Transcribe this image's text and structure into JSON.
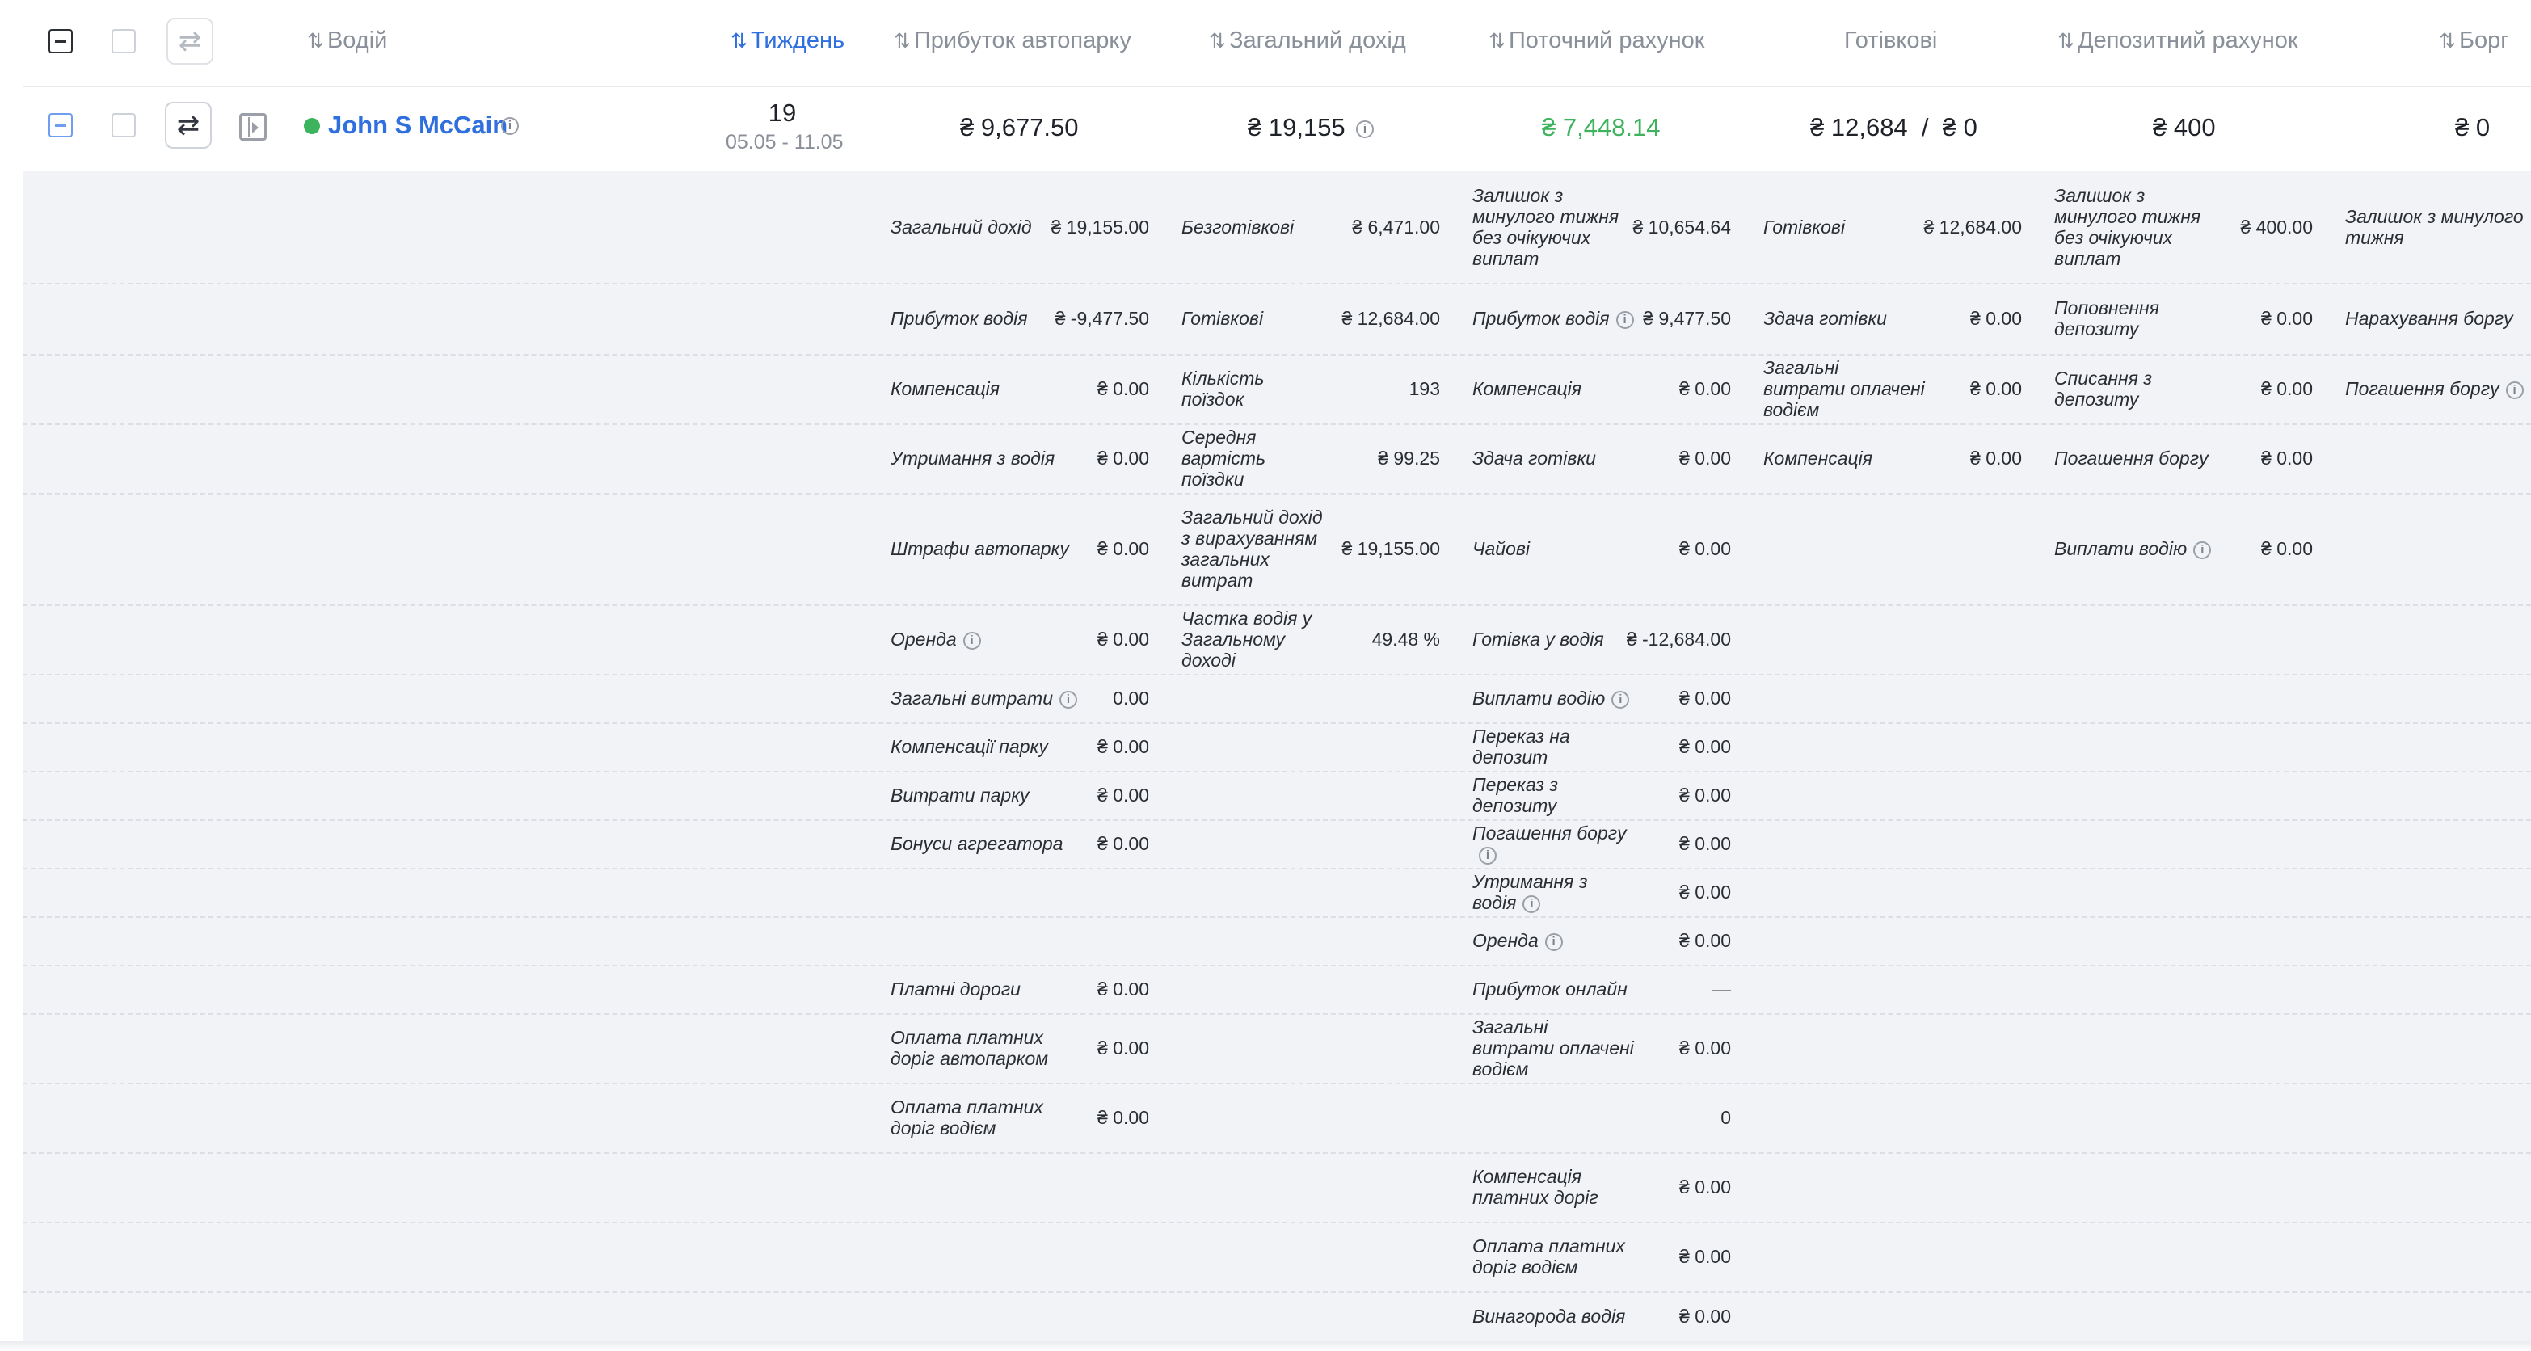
{
  "header": {
    "columns": [
      {
        "label": "Водій",
        "sort": "⇅"
      },
      {
        "label": "Тиждень",
        "sort": "⇅",
        "active": true
      },
      {
        "label": "Прибуток автопарку",
        "sort": "⇅"
      },
      {
        "label": "Загальний дохід",
        "sort": "⇅"
      },
      {
        "label": "Поточний рахунок",
        "sort": "⇅"
      },
      {
        "label": "Готівкові",
        "sort": ""
      },
      {
        "label": "Депозитний рахунок",
        "sort": "⇅"
      },
      {
        "label": "Борг",
        "sort": "⇅"
      }
    ],
    "swap_icon": "⇄"
  },
  "row": {
    "status_color": "#3cb35c",
    "driver_name": "John S McCain",
    "week_number": "19",
    "week_range": "05.05 - 11.05",
    "fleet_profit": "₴ 9,677.50",
    "total_income": "₴ 19,155",
    "current_account": "₴ 7,448.14",
    "cash": "₴ 12,684  /  ₴ 0",
    "deposit": "₴ 400",
    "debt": "₴ 0"
  },
  "colors": {
    "accent": "#2f6fde",
    "positive": "#3cb35c"
  },
  "details": {
    "col1": [
      {
        "label": "Загальний дохід",
        "value": "₴ 19,155.00"
      },
      {
        "label": "Прибуток водія",
        "value": "₴ -9,477.50"
      },
      {
        "label": "Компенсація",
        "value": "₴ 0.00"
      },
      {
        "label": "Утримання з водія",
        "value": "₴ 0.00"
      },
      {
        "label": "Штрафи автопарку",
        "value": "₴ 0.00"
      },
      {
        "label": "Оренда",
        "value": "₴ 0.00",
        "info": true
      },
      {
        "label": "Загальні витрати",
        "value": "0.00",
        "info": true
      },
      {
        "label": "Компенсації парку",
        "value": "₴ 0.00"
      },
      {
        "label": "Витрати парку",
        "value": "₴ 0.00"
      },
      {
        "label": "Бонуси агрегатора",
        "value": "₴ 0.00"
      },
      {
        "label": "Платні дороги",
        "value": "₴ 0.00"
      },
      {
        "label": "Оплата платних доріг автопарком",
        "value": "₴ 0.00"
      },
      {
        "label": "Оплата платних доріг водієм",
        "value": "₴ 0.00"
      }
    ],
    "col2": [
      {
        "label": "Безготівкові",
        "value": "₴ 6,471.00"
      },
      {
        "label": "Готівкові",
        "value": "₴ 12,684.00"
      },
      {
        "label": "Кількість поїздок",
        "value": "193"
      },
      {
        "label": "Середня вартість поїздки",
        "value": "₴ 99.25"
      },
      {
        "label": "Загальний дохід з вирахуванням загальних витрат",
        "value": "₴ 19,155.00"
      },
      {
        "label": "Частка водія у Загальному доході",
        "value": "49.48 %"
      }
    ],
    "col3": [
      {
        "label": "Залишок з минулого тижня без очікуючих виплат",
        "value": "₴ 10,654.64"
      },
      {
        "label": "Прибуток водія",
        "value": "₴ 9,477.50",
        "info": true
      },
      {
        "label": "Компенсація",
        "value": "₴ 0.00"
      },
      {
        "label": "Здача готівки",
        "value": "₴ 0.00"
      },
      {
        "label": "Чайові",
        "value": "₴ 0.00"
      },
      {
        "label": "Готівка у водія",
        "value": "₴ -12,684.00"
      },
      {
        "label": "Виплати водію",
        "value": "₴ 0.00",
        "info": true
      },
      {
        "label": "Переказ на депозит",
        "value": "₴ 0.00"
      },
      {
        "label": "Переказ з депозиту",
        "value": "₴ 0.00"
      },
      {
        "label": "Погашення боргу",
        "value": "₴ 0.00",
        "info": true
      },
      {
        "label": "Утримання з водія",
        "value": "₴ 0.00",
        "info": true
      },
      {
        "label": "Оренда",
        "value": "₴ 0.00",
        "info": true
      },
      {
        "label": "Прибуток онлайн",
        "value": "—"
      },
      {
        "label": "Загальні витрати оплачені водієм",
        "value": "₴ 0.00"
      },
      {
        "label": "",
        "value": "0"
      },
      {
        "label": "Компенсація платних доріг",
        "value": "₴ 0.00"
      },
      {
        "label": "Оплата платних доріг водієм",
        "value": "₴ 0.00"
      },
      {
        "label": "Винагорода водія",
        "value": "₴ 0.00"
      }
    ],
    "col4": [
      {
        "label": "Готівкові",
        "value": "₴ 12,684.00"
      },
      {
        "label": "Здача готівки",
        "value": "₴ 0.00"
      },
      {
        "label": "Загальні витрати оплачені водієм",
        "value": "₴ 0.00"
      },
      {
        "label": "Компенсація",
        "value": "₴ 0.00"
      }
    ],
    "col5": [
      {
        "label": "Залишок з минулого тижня без очікуючих виплат",
        "value": "₴ 400.00"
      },
      {
        "label": "Поповнення депозиту",
        "value": "₴ 0.00"
      },
      {
        "label": "Списання з депозиту",
        "value": "₴ 0.00"
      },
      {
        "label": "Погашення боргу",
        "value": "₴ 0.00"
      },
      {
        "label": "Виплати водію",
        "value": "₴ 0.00",
        "info": true
      }
    ],
    "col6": [
      {
        "label": "Залишок з минулого тижня",
        "value": ""
      },
      {
        "label": "Нарахування боргу",
        "value": ""
      },
      {
        "label": "Погашення боргу",
        "value": "",
        "info": true
      }
    ]
  }
}
